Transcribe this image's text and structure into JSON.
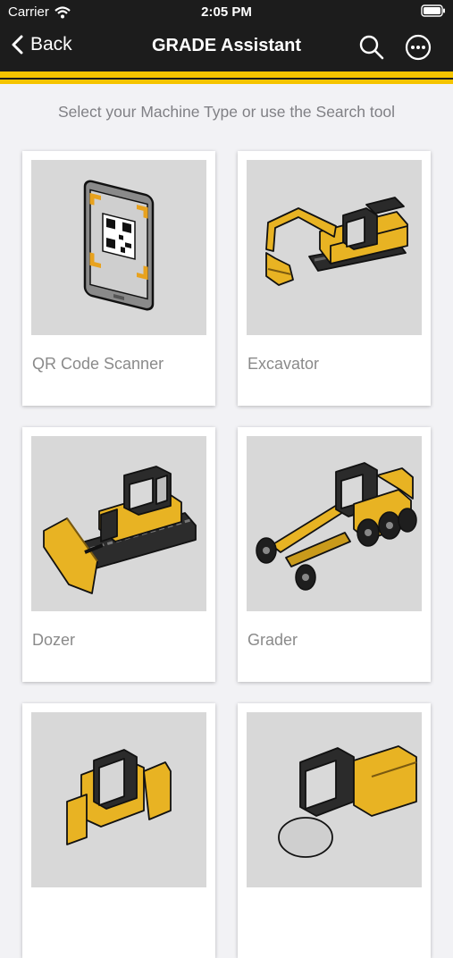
{
  "status_bar": {
    "carrier": "Carrier",
    "time": "2:05 PM"
  },
  "nav": {
    "back_label": "Back",
    "title": "GRADE Assistant",
    "search_icon": "search-icon",
    "more_icon": "more-options-icon"
  },
  "subtitle": "Select your Machine Type or use the Search tool",
  "machines": [
    {
      "label": "QR Code Scanner",
      "icon": "qr-code-scanner-icon"
    },
    {
      "label": "Excavator",
      "icon": "excavator-icon"
    },
    {
      "label": "Dozer",
      "icon": "dozer-icon"
    },
    {
      "label": "Grader",
      "icon": "grader-icon"
    },
    {
      "label": "",
      "icon": "compact-track-loader-icon"
    },
    {
      "label": "",
      "icon": "compactor-icon"
    }
  ],
  "colors": {
    "accent": "#f5c400",
    "bar": "#1c1c1c",
    "machine_yellow": "#e8b323"
  }
}
